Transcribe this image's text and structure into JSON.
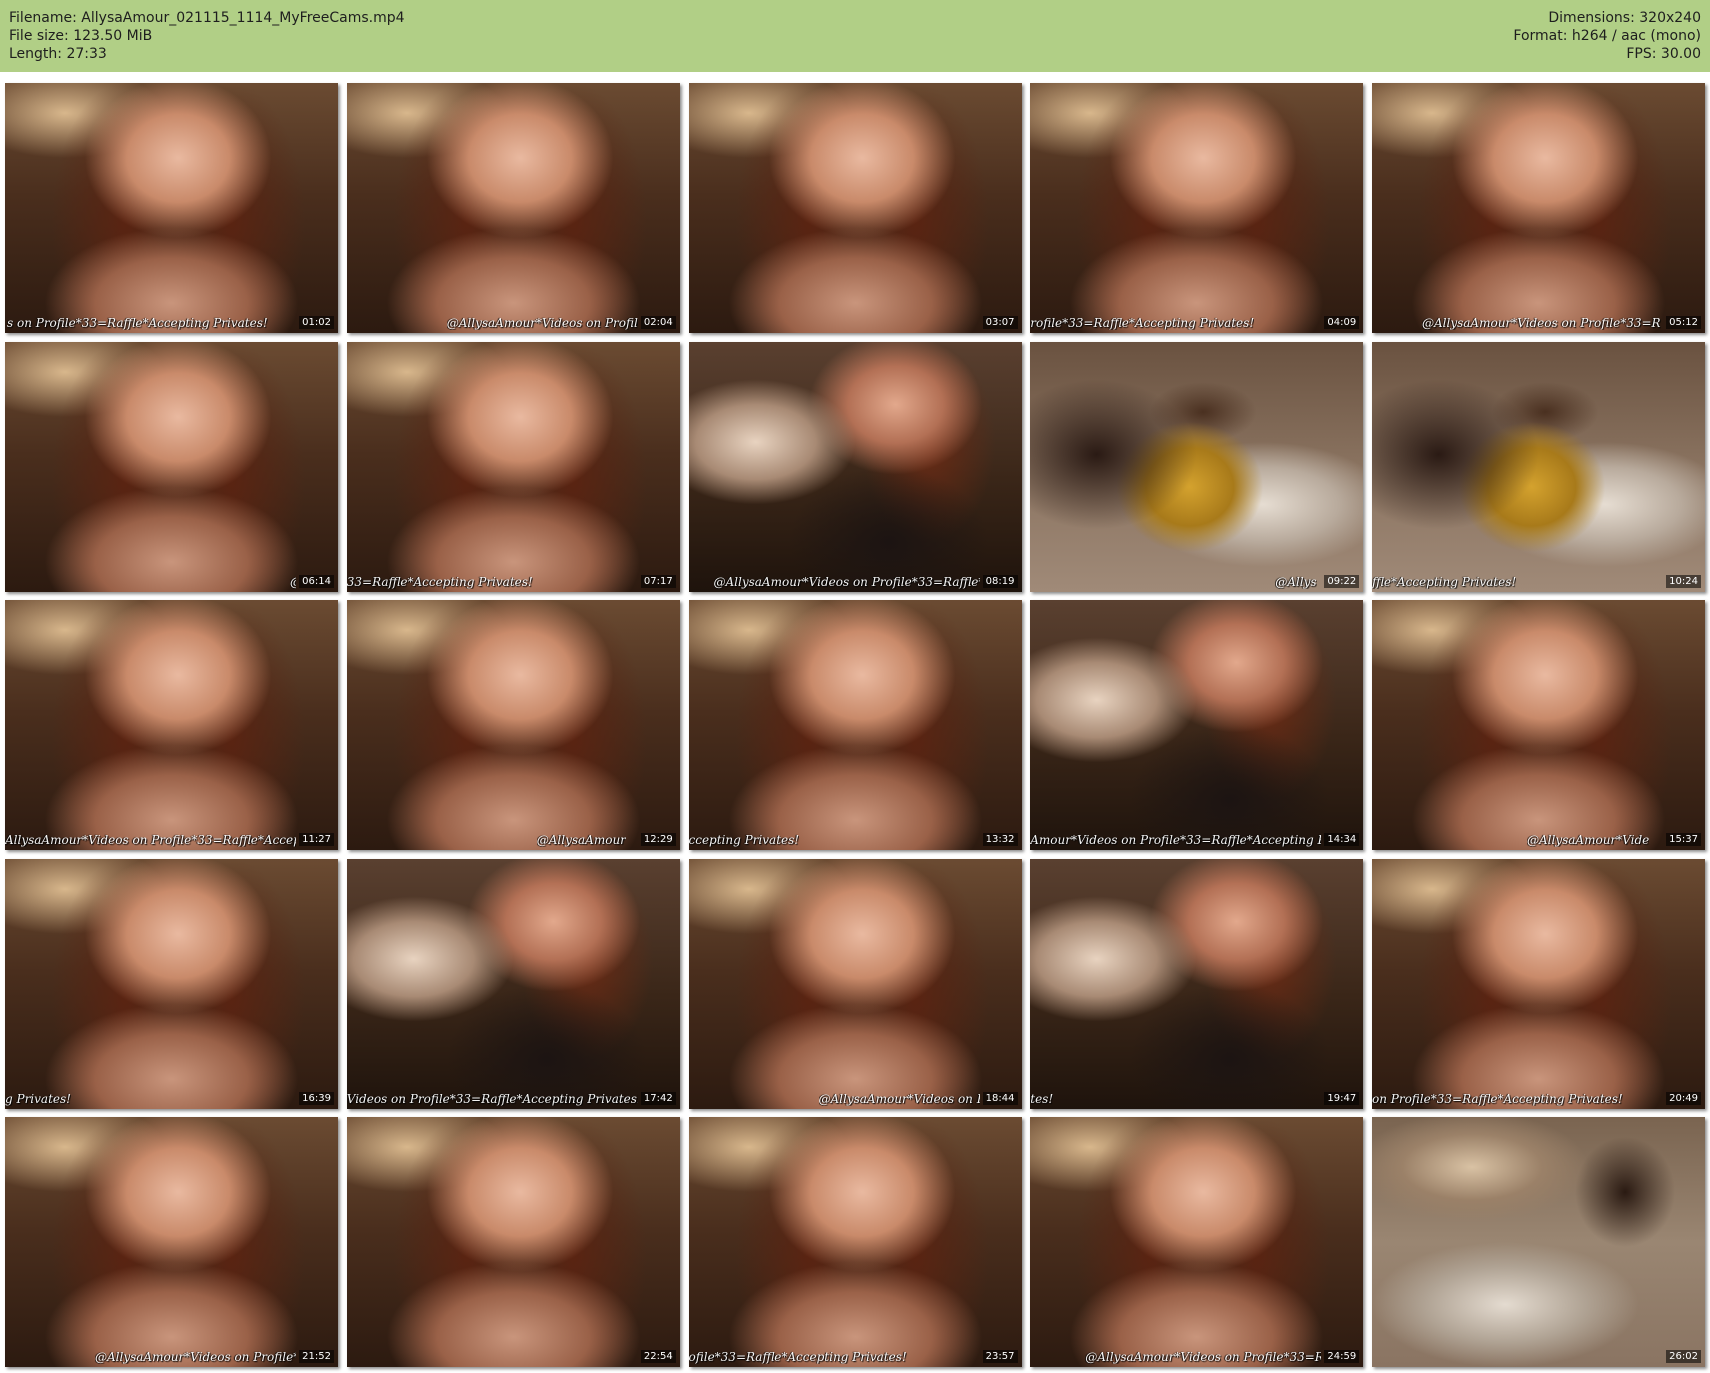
{
  "header": {
    "filename_line": "Filename: AllysaAmour_021115_1114_MyFreeCams.mp4",
    "filesize_line": "File size: 123.50 MiB",
    "length_line": "Length: 27:33",
    "dimensions_line": "Dimensions: 320x240",
    "format_line": "Format: h264 / aac (mono)",
    "fps_line": "FPS: 30.00"
  },
  "colors": {
    "header_bg": "#b1cf86",
    "page_bg": "#ffffff"
  },
  "thumbnails": [
    {
      "timestamp": "01:02",
      "overlay": "s on Profile*33=Raffle*Accepting Privates!",
      "scene": "a"
    },
    {
      "timestamp": "02:04",
      "overlay": "@AllysaAmour*Videos on Profile",
      "scene": "a"
    },
    {
      "timestamp": "03:07",
      "overlay": "",
      "scene": "a"
    },
    {
      "timestamp": "04:09",
      "overlay": "rofile*33=Raffle*Accepting Privates!",
      "scene": "a"
    },
    {
      "timestamp": "05:12",
      "overlay": "@AllysaAmour*Videos on Profile*33=R",
      "scene": "a"
    },
    {
      "timestamp": "06:14",
      "overlay": "@",
      "scene": "a"
    },
    {
      "timestamp": "07:17",
      "overlay": "33=Raffle*Accepting Privates!",
      "scene": "a"
    },
    {
      "timestamp": "08:19",
      "overlay": "@AllysaAmour*Videos on Profile*33=Raffle*",
      "scene": "b"
    },
    {
      "timestamp": "09:22",
      "overlay": "@Allys",
      "scene": "c"
    },
    {
      "timestamp": "10:24",
      "overlay": "ffle*Accepting Privates!",
      "scene": "c"
    },
    {
      "timestamp": "11:27",
      "overlay": "AllysaAmour*Videos on Profile*33=Raffle*Accep",
      "scene": "a"
    },
    {
      "timestamp": "12:29",
      "overlay": "@AllysaAmour",
      "scene": "a"
    },
    {
      "timestamp": "13:32",
      "overlay": "ccepting Privates!",
      "scene": "a"
    },
    {
      "timestamp": "14:34",
      "overlay": "Amour*Videos on Profile*33=Raffle*Accepting Pri",
      "scene": "b"
    },
    {
      "timestamp": "15:37",
      "overlay": "@AllysaAmour*Vide",
      "scene": "a"
    },
    {
      "timestamp": "16:39",
      "overlay": "g Privates!",
      "scene": "a"
    },
    {
      "timestamp": "17:42",
      "overlay": "Videos on Profile*33=Raffle*Accepting Privates!",
      "scene": "b"
    },
    {
      "timestamp": "18:44",
      "overlay": "@AllysaAmour*Videos on Pr",
      "scene": "a"
    },
    {
      "timestamp": "19:47",
      "overlay": "tes!",
      "scene": "b"
    },
    {
      "timestamp": "20:49",
      "overlay": "on Profile*33=Raffle*Accepting Privates!",
      "scene": "a"
    },
    {
      "timestamp": "21:52",
      "overlay": "@AllysaAmour*Videos on Profile*",
      "scene": "a"
    },
    {
      "timestamp": "22:54",
      "overlay": "",
      "scene": "a"
    },
    {
      "timestamp": "23:57",
      "overlay": "ofile*33=Raffle*Accepting Privates!",
      "scene": "a"
    },
    {
      "timestamp": "24:59",
      "overlay": "@AllysaAmour*Videos on Profile*33=Ro",
      "scene": "a"
    },
    {
      "timestamp": "26:02",
      "overlay": "",
      "scene": "d"
    }
  ]
}
